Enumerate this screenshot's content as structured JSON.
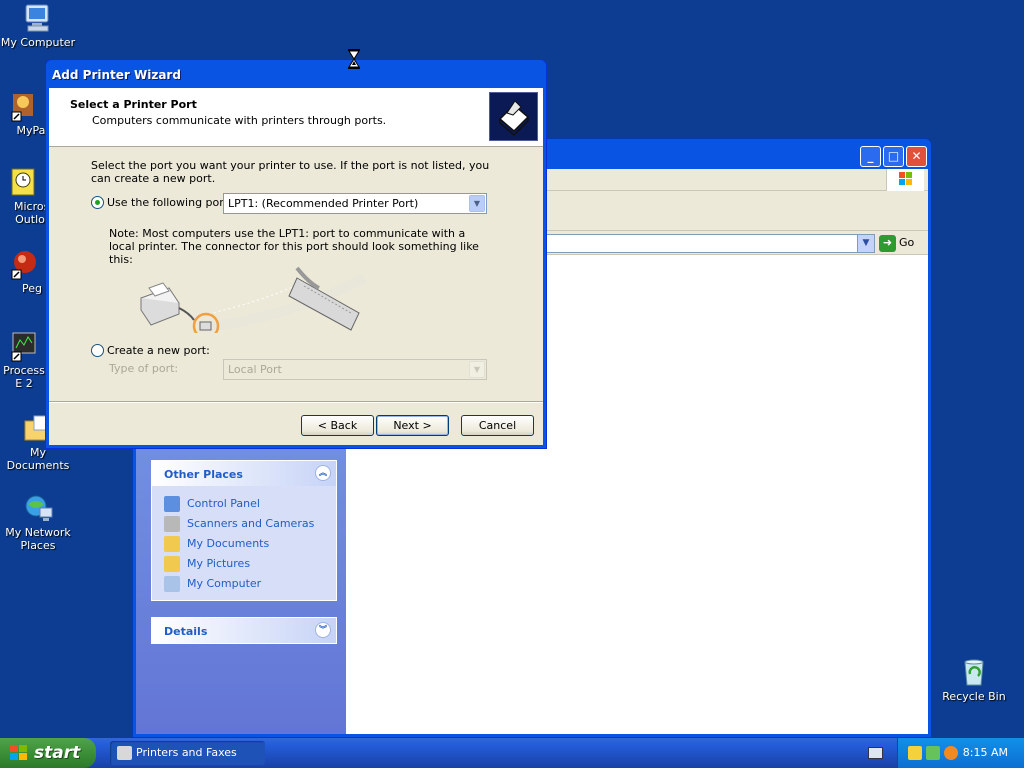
{
  "desktop": {
    "icons": [
      {
        "label": "My Computer",
        "icon": "computer-icon"
      },
      {
        "label": "MyPa",
        "icon": "mypaint-shortcut-icon"
      },
      {
        "label": "Micros Outlo",
        "icon": "outlook-shortcut-icon"
      },
      {
        "label": "Peg",
        "icon": "pegasus-shortcut-icon"
      },
      {
        "label": "Process E 2",
        "icon": "process-explorer-shortcut-icon"
      },
      {
        "label": "My Documents",
        "icon": "folder-documents-icon"
      },
      {
        "label": "My Network Places",
        "icon": "network-places-icon"
      },
      {
        "label": "Recycle Bin",
        "icon": "recycle-bin-icon"
      }
    ]
  },
  "explorer": {
    "go_label": "Go",
    "other_places": {
      "title": "Other Places",
      "items": [
        "Control Panel",
        "Scanners and Cameras",
        "My Documents",
        "My Pictures",
        "My Computer"
      ]
    },
    "details": {
      "title": "Details"
    }
  },
  "wizard": {
    "title": "Add Printer Wizard",
    "header_title": "Select a Printer Port",
    "header_subtitle": "Computers communicate with printers through ports.",
    "instruction": "Select the port you want your printer to use.  If the port is not listed, you can create a new port.",
    "use_port_label": "Use the following port:",
    "use_port_value": "LPT1: (Recommended Printer Port)",
    "note": "Note: Most computers use the LPT1: port to communicate with a local printer. The connector for this port should look something like this:",
    "create_port_label": "Create a new port:",
    "type_of_port_label": "Type of port:",
    "type_of_port_value": "Local Port",
    "buttons": {
      "back": "< Back",
      "next": "Next >",
      "cancel": "Cancel"
    }
  },
  "taskbar": {
    "start_label": "start",
    "task_label": "Printers and Faxes",
    "clock": "8:15 AM"
  },
  "colors": {
    "desktop": "#0c3d92",
    "titlebar": "#0a54e3",
    "dialog_face": "#ece9d8",
    "start_green": "#3c8f37",
    "link_blue": "#215dc6"
  }
}
